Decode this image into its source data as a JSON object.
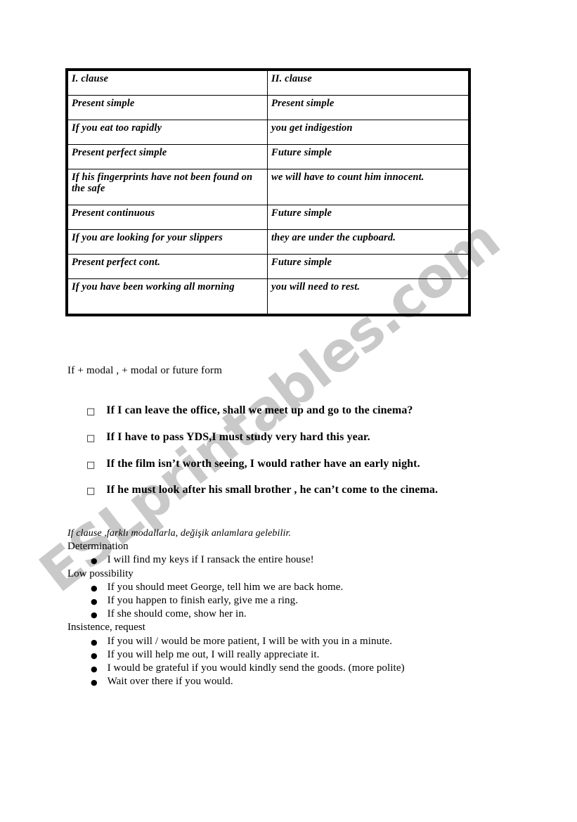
{
  "watermark": {
    "text": "ESLprintables.com",
    "color": "#c9c9c9"
  },
  "table": {
    "headers": {
      "col_a": "I. clause",
      "col_b": "II. clause"
    },
    "rows": [
      {
        "col_a": "Present simple",
        "col_b": "Present simple",
        "size": "std"
      },
      {
        "col_a": "If you eat too rapidly",
        "col_b": "you get indigestion",
        "size": "std"
      },
      {
        "col_a": "Present perfect simple",
        "col_b": "Future simple",
        "size": "std"
      },
      {
        "col_a": "If his fingerprints have not been found on the safe",
        "col_b": "we will have to count him innocent.",
        "size": "tall"
      },
      {
        "col_a": "Present continuous",
        "col_b": "Future simple",
        "size": "std"
      },
      {
        "col_a": "If you are looking for your slippers",
        "col_b": "they are under the cupboard.",
        "size": "std"
      },
      {
        "col_a": "Present perfect cont.",
        "col_b": "Future simple",
        "size": "std"
      },
      {
        "col_a": "If you have been working all morning",
        "col_b": "you will need to rest.",
        "size": "last"
      }
    ]
  },
  "formula": {
    "text": "If + modal ,  + modal or future form"
  },
  "checkbox_items": {
    "marker": "□",
    "items": [
      "If I can leave the office, shall we meet up and go to the cinema?",
      "If I have to pass YDS,I must study very hard this year.",
      "If the film isn’t worth seeing, I would rather have an early night.",
      "If he must look after his small brother , he can’t come to the cinema."
    ]
  },
  "modal_meanings": {
    "intro": "If clause ,farklı modallarla, değişik anlamlara gelebilir.",
    "bullet_marker": "●",
    "groups": [
      {
        "heading": "Determination",
        "items": [
          "I will find my keys if I ransack the entire house!"
        ]
      },
      {
        "heading": "Low possibility",
        "items": [
          "If you should meet George, tell him we are back home.",
          "If you happen to finish early, give me a ring.",
          "If she should come, show her in."
        ]
      },
      {
        "heading": "Insistence, request",
        "items": [
          "If you will / would be more patient, I will be with you in a minute.",
          "If you will help me out, I will really  appreciate it.",
          "I would be grateful if you would kindly send the goods. (more polite)",
          "Wait over there if you would."
        ]
      }
    ]
  }
}
